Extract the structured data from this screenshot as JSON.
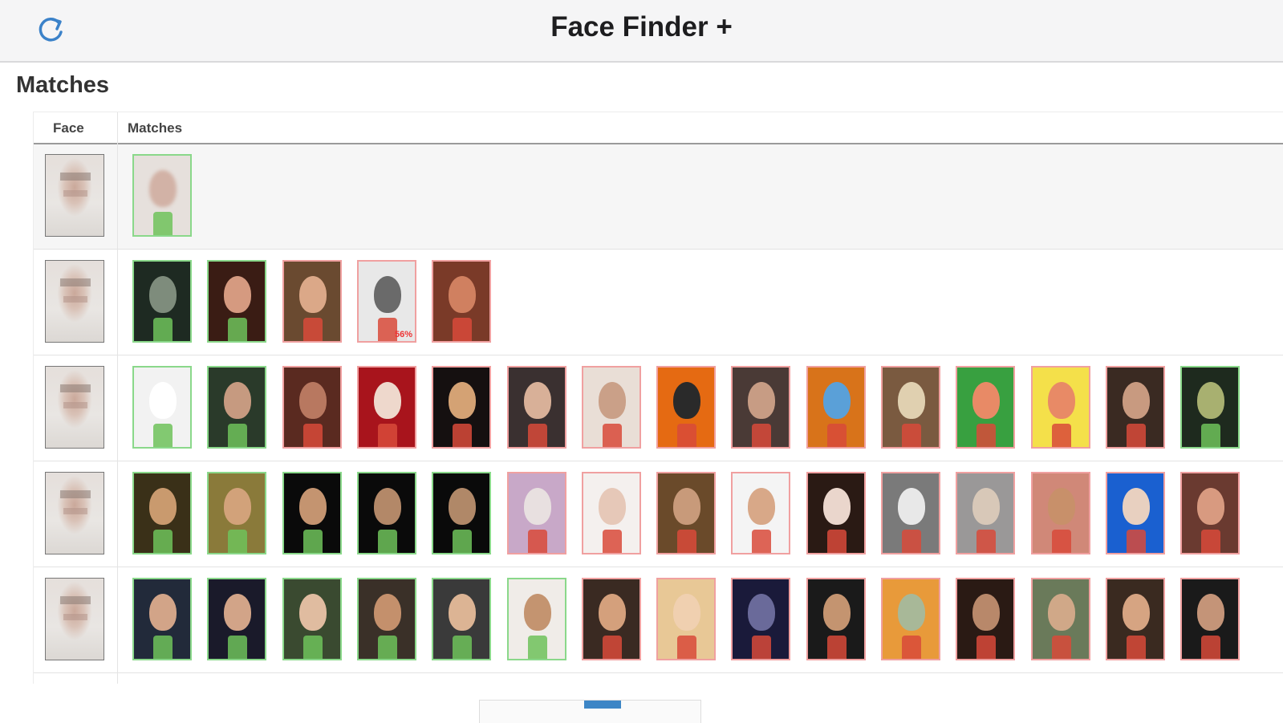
{
  "app": {
    "title": "Face Finder +"
  },
  "section": {
    "title": "Matches"
  },
  "table": {
    "headers": {
      "face": "Face",
      "matches": "Matches"
    },
    "rows": [
      {
        "matches": [
          {
            "ok": true,
            "bg": "#e6e0dc",
            "skin": "#d2b2a6",
            "blurred": true
          }
        ]
      },
      {
        "matches": [
          {
            "ok": true,
            "bg": "#1e2a22",
            "skin": "#7e8c7c"
          },
          {
            "ok": true,
            "bg": "#3a1c14",
            "skin": "#d59a80"
          },
          {
            "ok": false,
            "bg": "#6a4a30",
            "skin": "#dba888"
          },
          {
            "ok": false,
            "bg": "#e8e8e8",
            "skin": "#6a6a6a",
            "pct": "56%"
          },
          {
            "ok": false,
            "bg": "#7a3a28",
            "skin": "#d08060"
          }
        ]
      },
      {
        "matches": [
          {
            "ok": true,
            "bg": "#f2f2f2",
            "skin": "#ffffff"
          },
          {
            "ok": true,
            "bg": "#2a3a2a",
            "skin": "#c69a80"
          },
          {
            "ok": false,
            "bg": "#5a2a20",
            "skin": "#b87860"
          },
          {
            "ok": false,
            "bg": "#a8141c",
            "skin": "#eed8cc"
          },
          {
            "ok": false,
            "bg": "#151010",
            "skin": "#d4a274"
          },
          {
            "ok": false,
            "bg": "#3a3030",
            "skin": "#d8b098"
          },
          {
            "ok": false,
            "bg": "#e9ded6",
            "skin": "#caa088"
          },
          {
            "ok": false,
            "bg": "#e56a12",
            "skin": "#2a2a2a"
          },
          {
            "ok": false,
            "bg": "#4a3a36",
            "skin": "#c79c84"
          },
          {
            "ok": false,
            "bg": "#d8731a",
            "skin": "#5aa0d8"
          },
          {
            "ok": false,
            "bg": "#7a5a40",
            "skin": "#e0d0b0"
          },
          {
            "ok": false,
            "bg": "#38a040",
            "skin": "#e88a66"
          },
          {
            "ok": false,
            "bg": "#f4e04a",
            "skin": "#e88a66"
          },
          {
            "ok": false,
            "bg": "#3a2a22",
            "skin": "#c89a80"
          },
          {
            "ok": true,
            "bg": "#1e2a1e",
            "skin": "#a8b070"
          }
        ]
      },
      {
        "matches": [
          {
            "ok": true,
            "bg": "#3a3018",
            "skin": "#c99a6e"
          },
          {
            "ok": true,
            "bg": "#8a7a3a",
            "skin": "#d2a27a"
          },
          {
            "ok": true,
            "bg": "#0a0a0a",
            "skin": "#c49470"
          },
          {
            "ok": true,
            "bg": "#0a0a0a",
            "skin": "#b38868"
          },
          {
            "ok": true,
            "bg": "#0a0a0a",
            "skin": "#b08868"
          },
          {
            "ok": false,
            "bg": "#c8a8c8",
            "skin": "#e8e0e0"
          },
          {
            "ok": false,
            "bg": "#f4f0ee",
            "skin": "#e6c8b8"
          },
          {
            "ok": false,
            "bg": "#6a4a2a",
            "skin": "#c89a7a"
          },
          {
            "ok": false,
            "bg": "#f4f4f4",
            "skin": "#d8a888"
          },
          {
            "ok": false,
            "bg": "#2a1a14",
            "skin": "#ead6cc"
          },
          {
            "ok": false,
            "bg": "#7a7a7a",
            "skin": "#e8e8e8"
          },
          {
            "ok": false,
            "bg": "#9a9898",
            "skin": "#d8c8b8"
          },
          {
            "ok": false,
            "bg": "#d08878",
            "skin": "#c8906a"
          },
          {
            "ok": false,
            "bg": "#1a60d0",
            "skin": "#e8d0c0"
          },
          {
            "ok": false,
            "bg": "#6a3a30",
            "skin": "#d89a80"
          }
        ]
      },
      {
        "matches": [
          {
            "ok": true,
            "bg": "#222a3a",
            "skin": "#d2a488"
          },
          {
            "ok": true,
            "bg": "#1a1a2a",
            "skin": "#d2a488"
          },
          {
            "ok": true,
            "bg": "#3a4a30",
            "skin": "#e0bca0"
          },
          {
            "ok": true,
            "bg": "#3a3028",
            "skin": "#c4906c"
          },
          {
            "ok": true,
            "bg": "#3a3a3a",
            "skin": "#dcb494"
          },
          {
            "ok": true,
            "bg": "#f0ece8",
            "skin": "#c49470"
          },
          {
            "ok": false,
            "bg": "#3a2a22",
            "skin": "#d4a07c"
          },
          {
            "ok": false,
            "bg": "#e8c896",
            "skin": "#f0d0b0"
          },
          {
            "ok": false,
            "bg": "#1a1a3a",
            "skin": "#6a6a9a"
          },
          {
            "ok": false,
            "bg": "#1a1a1a",
            "skin": "#c49470"
          },
          {
            "ok": false,
            "bg": "#e89a3a",
            "skin": "#a8b898"
          },
          {
            "ok": false,
            "bg": "#2a1a14",
            "skin": "#b8886a"
          },
          {
            "ok": false,
            "bg": "#6a7a5a",
            "skin": "#d0a888"
          },
          {
            "ok": false,
            "bg": "#3a2a20",
            "skin": "#d6a482"
          },
          {
            "ok": false,
            "bg": "#1a1a1a",
            "skin": "#c49478"
          }
        ]
      }
    ]
  },
  "colors": {
    "match_ok_border": "#8ad88a",
    "match_bad_border": "#f0a0a0",
    "accent": "#3d86c6"
  },
  "icons": {
    "refresh": "refresh-icon"
  }
}
